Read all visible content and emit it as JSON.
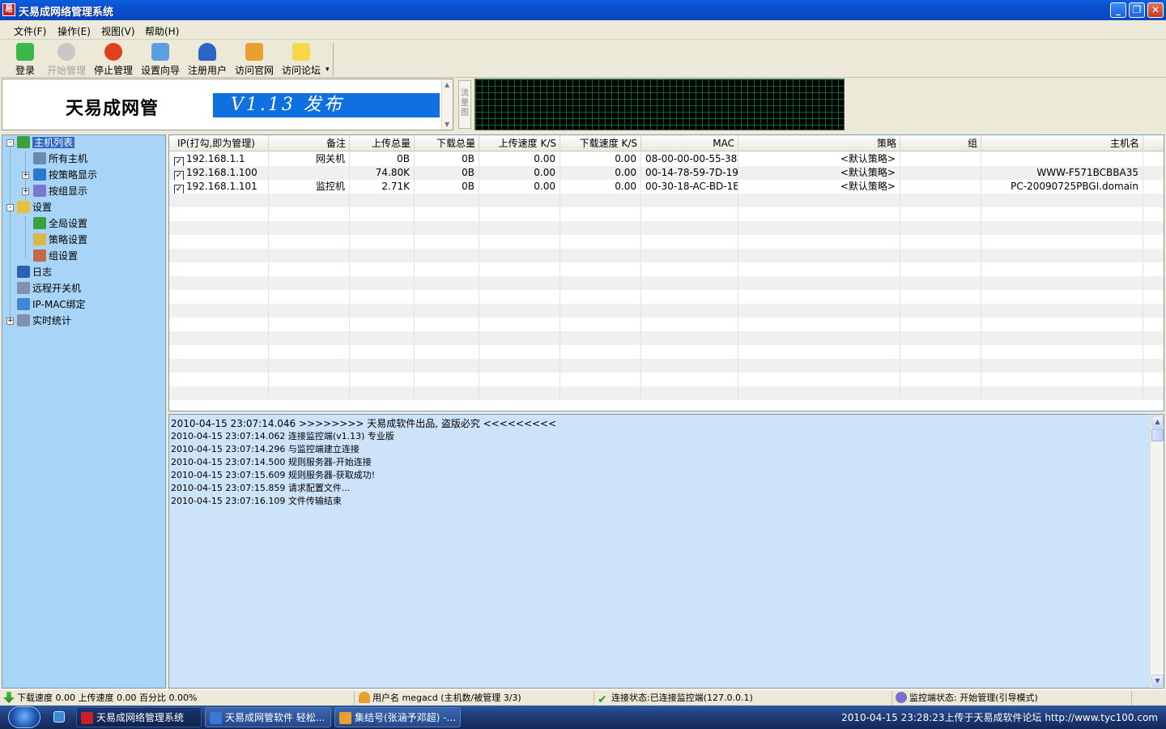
{
  "window": {
    "title": "天易成网络管理系统",
    "min": "_",
    "max": "❐",
    "close": "✕"
  },
  "menu": [
    "文件(F)",
    "操作(E)",
    "视图(V)",
    "帮助(H)"
  ],
  "toolbar": {
    "buttons": [
      {
        "label": "登录",
        "icon": "login-icon",
        "color": "#3cb84a",
        "disabled": false
      },
      {
        "label": "开始管理",
        "icon": "start-manage-icon",
        "color": "#9e9e9e",
        "disabled": true
      },
      {
        "label": "停止管理",
        "icon": "stop-manage-icon",
        "color": "#e04020",
        "disabled": false
      },
      {
        "label": "设置向导",
        "icon": "wizard-icon",
        "color": "#5b9fe0",
        "disabled": false
      },
      {
        "label": "注册用户",
        "icon": "register-user-icon",
        "color": "#2a66c8",
        "disabled": false
      },
      {
        "label": "访问官网",
        "icon": "home-icon",
        "color": "#e8a030",
        "disabled": false
      },
      {
        "label": "访问论坛",
        "icon": "forum-icon",
        "color": "#f6d84a",
        "disabled": false
      }
    ],
    "more": "▾"
  },
  "banner": {
    "logo_text": "天易成网管",
    "headline": "V1.13 发布",
    "flow_tab": "流量图"
  },
  "tree": [
    {
      "label": "主机列表",
      "icon": "host-list-icon",
      "color": "#3aa040",
      "selected": true
    },
    {
      "label": "所有主机",
      "icon": "computer-icon",
      "color": "#6a8ab0"
    },
    {
      "label": "按策略显示",
      "icon": "monitor-icon",
      "color": "#2a78d0"
    },
    {
      "label": "按组显示",
      "icon": "group-monitor-icon",
      "color": "#7a78d0"
    },
    {
      "label": "设置",
      "icon": "settings-icon",
      "color": "#e8c040"
    },
    {
      "label": "全局设置",
      "icon": "global-settings-icon",
      "color": "#3aa040"
    },
    {
      "label": "策略设置",
      "icon": "policy-settings-icon",
      "color": "#d8b848"
    },
    {
      "label": "组设置",
      "icon": "group-settings-icon",
      "color": "#c06848"
    },
    {
      "label": "日志",
      "icon": "log-icon",
      "color": "#3060b0"
    },
    {
      "label": "远程开关机",
      "icon": "remote-power-icon",
      "color": "#8090b0"
    },
    {
      "label": "IP-MAC绑定",
      "icon": "ip-mac-icon",
      "color": "#4088d0"
    },
    {
      "label": "实时统计",
      "icon": "realtime-stats-icon",
      "color": "#8090b0"
    }
  ],
  "table": {
    "columns": [
      "IP(打勾,即为管理)",
      "备注",
      "上传总量",
      "下载总量",
      "上传速度 K/S",
      "下载速度 K/S",
      "MAC",
      "策略",
      "组",
      "主机名"
    ],
    "rows": [
      {
        "checked": "✓",
        "ip": "192.168.1.1",
        "note": "网关机",
        "up_total": "0B",
        "down_total": "0B",
        "up_speed": "0.00",
        "down_speed": "0.00",
        "mac": "08-00-00-00-55-38",
        "policy": "<默认策略>",
        "group": "",
        "hostname": ""
      },
      {
        "checked": "✓",
        "ip": "192.168.1.100",
        "note": "",
        "up_total": "74.80K",
        "down_total": "0B",
        "up_speed": "0.00",
        "down_speed": "0.00",
        "mac": "00-14-78-59-7D-19",
        "policy": "<默认策略>",
        "group": "",
        "hostname": "WWW-F571BCBBA35"
      },
      {
        "checked": "✓",
        "ip": "192.168.1.101",
        "note": "监控机",
        "up_total": "2.71K",
        "down_total": "0B",
        "up_speed": "0.00",
        "down_speed": "0.00",
        "mac": "00-30-18-AC-BD-1E",
        "policy": "<默认策略>",
        "group": "",
        "hostname": "PC-20090725PBGI.domain"
      }
    ]
  },
  "log": [
    "2010-04-15 23:07:14.046 >>>>>>>>  天易成软件出品, 盗版必究   <<<<<<<<<",
    "2010-04-15 23:07:14.062 连接监控端(v1.13) 专业版",
    "2010-04-15 23:07:14.296 与监控端建立连接",
    "2010-04-15 23:07:14.500 规则服务器-开始连接",
    "2010-04-15 23:07:15.609 规则服务器-获取成功!",
    "2010-04-15 23:07:15.859 请求配置文件...",
    "2010-04-15 23:07:16.109 文件传输结束"
  ],
  "status": {
    "speed": "下载速度 0.00 上传速度 0.00 百分比 0.00%",
    "user": "用户名 megacd (主机数/被管理 3/3)",
    "connection": "连接状态:已连接监控端(127.0.0.1)",
    "monitor": "监控端状态: 开始管理(引导模式)"
  },
  "taskbar": {
    "tasks": [
      {
        "label": "天易成网络管理系统",
        "icon_color": "#c8202a",
        "active": true
      },
      {
        "label": "天易成网管软件 轻松...",
        "icon_color": "#3a78d8",
        "active": false
      },
      {
        "label": "集结号(张涵予邓超) -...",
        "icon_color": "#e8a030",
        "active": false
      }
    ],
    "tray": "2010-04-15 23:28:23上传于天易成软件论坛 http://www.tyc100.com"
  }
}
